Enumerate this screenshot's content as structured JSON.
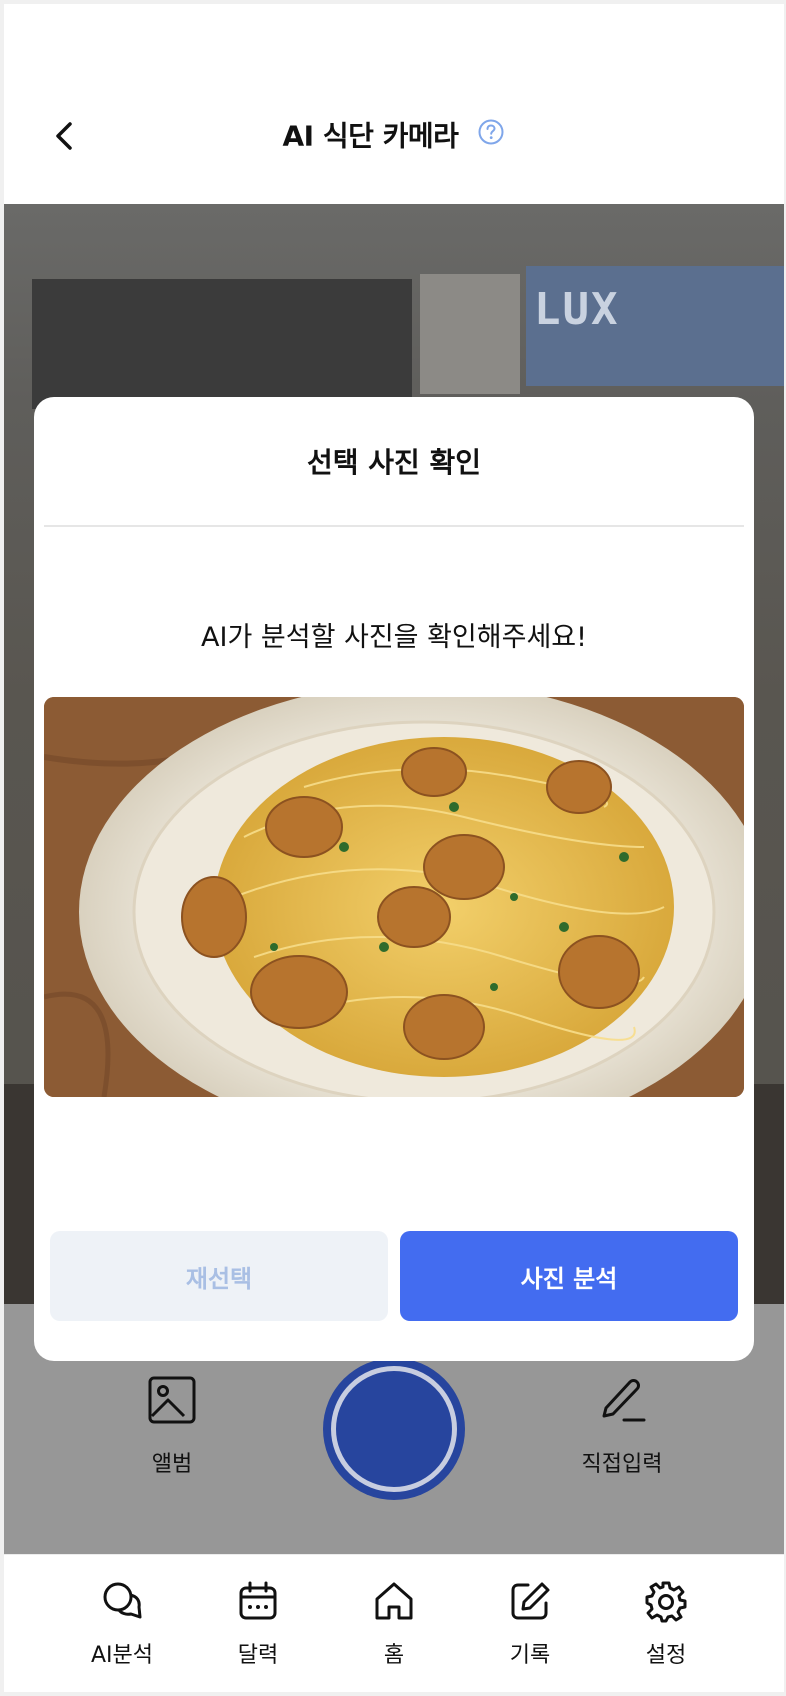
{
  "header": {
    "title": "AI 식단 카메라"
  },
  "camera": {
    "poster_text": "LUX"
  },
  "modal": {
    "title": "선택 사진 확인",
    "description": "AI가 분석할 사진을 확인해주세요!",
    "reselect_label": "재선택",
    "analyze_label": "사진 분석"
  },
  "controls": {
    "album_label": "앨범",
    "manual_label": "직접입력"
  },
  "nav": {
    "items": [
      {
        "label": "AI분석",
        "icon": "chat-bubbles-icon"
      },
      {
        "label": "달력",
        "icon": "calendar-icon"
      },
      {
        "label": "홈",
        "icon": "home-icon"
      },
      {
        "label": "기록",
        "icon": "edit-icon"
      },
      {
        "label": "설정",
        "icon": "gear-icon"
      }
    ]
  },
  "colors": {
    "primary": "#436cf0",
    "reselect_bg": "#eef2f7",
    "reselect_text": "#a9bfe4",
    "shutter": "#27459e",
    "help_icon": "#7fa6ea"
  }
}
